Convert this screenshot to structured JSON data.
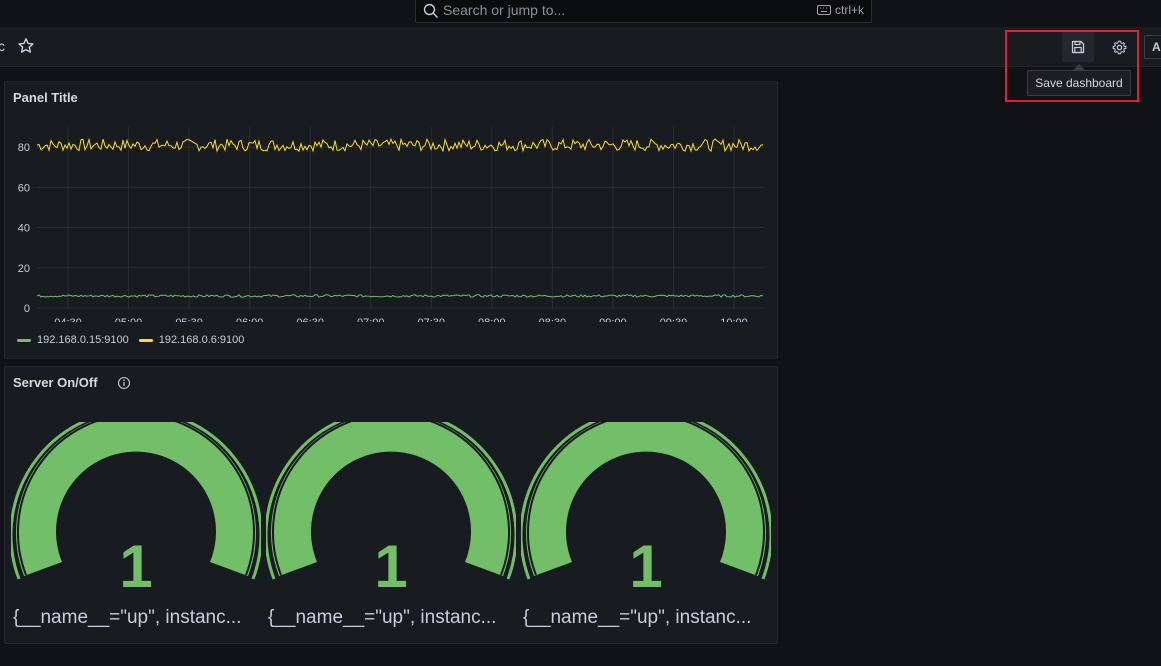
{
  "search": {
    "placeholder": "Search or jump to...",
    "shortcut": "ctrl+k"
  },
  "toolbar": {
    "crumb_fragment": "c",
    "add_label": "Ac"
  },
  "tooltip": {
    "text": "Save dashboard"
  },
  "panels": [
    {
      "title": "Panel Title",
      "legend": [
        {
          "name": "192.168.0.15:9100",
          "color": "#73bf69"
        },
        {
          "name": "192.168.0.6:9100",
          "color": "#fade2a"
        }
      ]
    },
    {
      "title": "Server On/Off",
      "gauges": [
        {
          "value": "1",
          "label": "{__name__=\"up\", instanc..."
        },
        {
          "value": "1",
          "label": "{__name__=\"up\", instanc..."
        },
        {
          "value": "1",
          "label": "{__name__=\"up\", instanc..."
        }
      ]
    }
  ],
  "chart_data": {
    "type": "line",
    "title": "Panel Title",
    "x_ticks": [
      "04:30",
      "05:00",
      "05:30",
      "06:00",
      "06:30",
      "07:00",
      "07:30",
      "08:00",
      "08:30",
      "09:00",
      "09:30",
      "10:00"
    ],
    "y_ticks": [
      0,
      20,
      40,
      60,
      80
    ],
    "ylim": [
      0,
      90
    ],
    "grid": true,
    "legend_position": "bottom-left",
    "series": [
      {
        "name": "192.168.0.6:9100",
        "color": "#fade2a",
        "approx_value": 81,
        "noise": 3
      },
      {
        "name": "192.168.0.15:9100",
        "color": "#73bf69",
        "approx_value": 6,
        "noise": 0.6
      }
    ]
  },
  "colors": {
    "gauge": "#73bf69",
    "highlight": "#e0202b",
    "background": "#111217",
    "panel": "#181b1f"
  }
}
